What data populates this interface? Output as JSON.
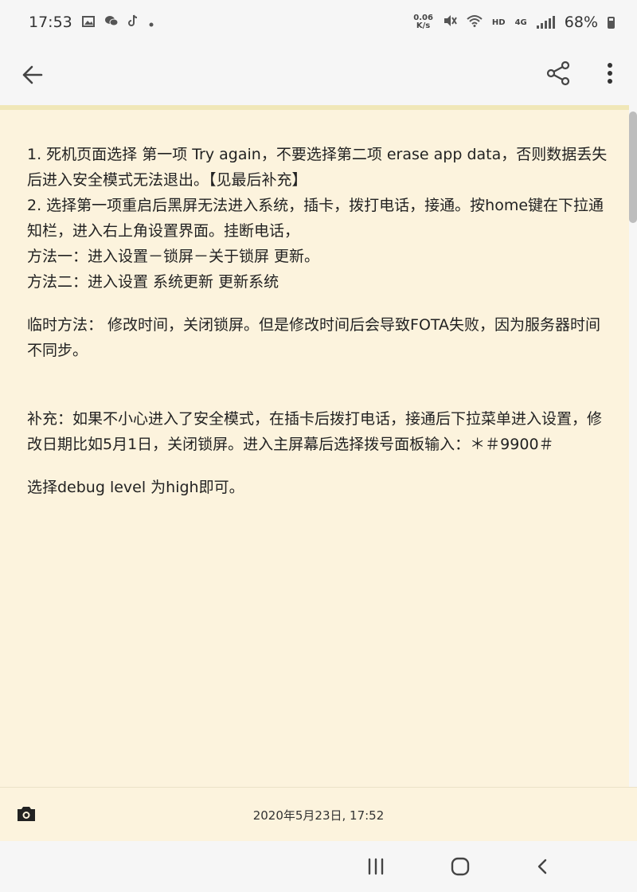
{
  "status_bar": {
    "time": "17:53",
    "net_speed_top": "0.06",
    "net_speed_bottom": "K/s",
    "hd": "HD",
    "network": "4G",
    "battery": "68%"
  },
  "note": {
    "lines": [
      "1. 死机页面选择 第一项 Try again，不要选择第二项 erase app data，否则数据丢失后进入安全模式无法退出。【见最后补充】",
      "2. 选择第一项重启后黑屏无法进入系统，插卡，拨打电话，接通。按home键在下拉通知栏，进入右上角设置界面。挂断电话，",
      "方法一：进入设置－锁屏－关于锁屏 更新。",
      "方法二：进入设置 系统更新 更新系统",
      "临时方法： 修改时间，关闭锁屏。但是修改时间后会导致FOTA失败，因为服务器时间不同步。",
      "补充：如果不小心进入了安全模式，在插卡后拨打电话，接通后下拉菜单进入设置，修改日期比如5月1日，关闭锁屏。进入主屏幕后选择拨号面板输入：＊＃9900＃",
      "选择debug level 为high即可。"
    ]
  },
  "footer": {
    "timestamp": "2020年5月23日, 17:52"
  },
  "icons": {
    "back": "back-arrow-icon",
    "share": "share-icon",
    "menu": "more-vert-icon",
    "camera": "camera-icon",
    "nav_recent": "recent-apps-icon",
    "nav_home": "home-icon",
    "nav_back": "nav-back-icon"
  }
}
